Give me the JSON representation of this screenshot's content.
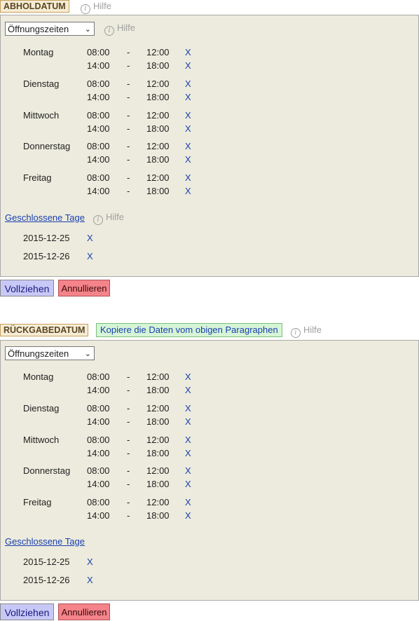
{
  "pickup": {
    "label": "ABHOLDATUM",
    "help": "Hilfe",
    "select_value": "Öffnungszeiten",
    "select_help": "Hilfe",
    "days": [
      {
        "name": "Montag",
        "slots": [
          [
            "08:00",
            "-",
            "12:00",
            "X"
          ],
          [
            "14:00",
            "-",
            "18:00",
            "X"
          ]
        ]
      },
      {
        "name": "Dienstag",
        "slots": [
          [
            "08:00",
            "-",
            "12:00",
            "X"
          ],
          [
            "14:00",
            "-",
            "18:00",
            "X"
          ]
        ]
      },
      {
        "name": "Mittwoch",
        "slots": [
          [
            "08:00",
            "-",
            "12:00",
            "X"
          ],
          [
            "14:00",
            "-",
            "18:00",
            "X"
          ]
        ]
      },
      {
        "name": "Donnerstag",
        "slots": [
          [
            "08:00",
            "-",
            "12:00",
            "X"
          ],
          [
            "14:00",
            "-",
            "18:00",
            "X"
          ]
        ]
      },
      {
        "name": "Freitag",
        "slots": [
          [
            "08:00",
            "-",
            "12:00",
            "X"
          ],
          [
            "14:00",
            "-",
            "18:00",
            "X"
          ]
        ]
      }
    ],
    "closed_label": "Geschlossene Tage",
    "closed_help": "Hilfe",
    "closed_days": [
      {
        "date": "2015-12-25",
        "x": "X"
      },
      {
        "date": "2015-12-26",
        "x": "X"
      }
    ],
    "ok_label": "Vollziehen",
    "cancel_label": "Annullieren"
  },
  "return": {
    "label": "RÜCKGABEDATUM",
    "copy_label": "Kopiere die Daten vom obigen Paragraphen",
    "help": "Hilfe",
    "select_value": "Öffnungszeiten",
    "days": [
      {
        "name": "Montag",
        "slots": [
          [
            "08:00",
            "-",
            "12:00",
            "X"
          ],
          [
            "14:00",
            "-",
            "18:00",
            "X"
          ]
        ]
      },
      {
        "name": "Dienstag",
        "slots": [
          [
            "08:00",
            "-",
            "12:00",
            "X"
          ],
          [
            "14:00",
            "-",
            "18:00",
            "X"
          ]
        ]
      },
      {
        "name": "Mittwoch",
        "slots": [
          [
            "08:00",
            "-",
            "12:00",
            "X"
          ],
          [
            "14:00",
            "-",
            "18:00",
            "X"
          ]
        ]
      },
      {
        "name": "Donnerstag",
        "slots": [
          [
            "08:00",
            "-",
            "12:00",
            "X"
          ],
          [
            "14:00",
            "-",
            "18:00",
            "X"
          ]
        ]
      },
      {
        "name": "Freitag",
        "slots": [
          [
            "08:00",
            "-",
            "12:00",
            "X"
          ],
          [
            "14:00",
            "-",
            "18:00",
            "X"
          ]
        ]
      }
    ],
    "closed_label": "Geschlossene Tage",
    "closed_days": [
      {
        "date": "2015-12-25",
        "x": "X"
      },
      {
        "date": "2015-12-26",
        "x": "X"
      }
    ],
    "ok_label": "Vollziehen",
    "cancel_label": "Annullieren"
  }
}
